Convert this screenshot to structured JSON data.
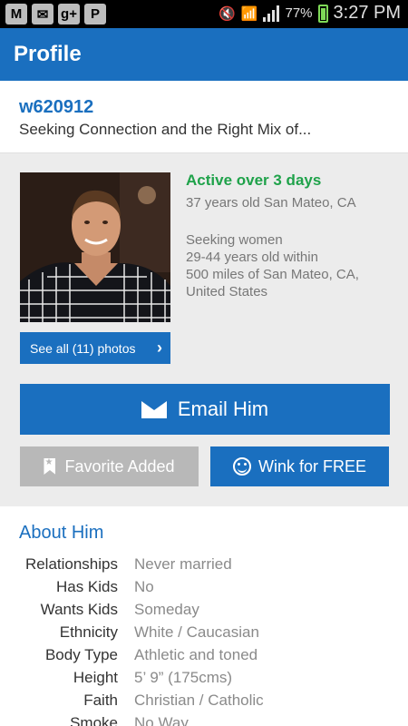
{
  "status_bar": {
    "icons": [
      "gmail-icon",
      "voicemail-icon",
      "google-plus-icon",
      "pinterest-icon"
    ],
    "icon_glyphs": [
      "M",
      "✉",
      "g+",
      "P"
    ],
    "battery": "77%",
    "time": "3:27 PM"
  },
  "appbar": {
    "title": "Profile"
  },
  "profile": {
    "username": "w620912",
    "headline": "Seeking Connection and the Right Mix of...",
    "activity": "Active over 3 days",
    "age_location": "37 years old San Mateo, CA",
    "seeking": {
      "line1": "Seeking women",
      "line2": "29-44 years old within",
      "line3": "500 miles of San Mateo, CA,",
      "line4": "United States"
    },
    "photos_button": "See all (11) photos"
  },
  "actions": {
    "email": "Email Him",
    "favorite": "Favorite Added",
    "wink": "Wink for FREE"
  },
  "about": {
    "title": "About Him",
    "details": [
      {
        "label": "Relationships",
        "value": "Never married"
      },
      {
        "label": "Has Kids",
        "value": "No"
      },
      {
        "label": "Wants Kids",
        "value": "Someday"
      },
      {
        "label": "Ethnicity",
        "value": "White / Caucasian"
      },
      {
        "label": "Body Type",
        "value": "Athletic and toned"
      },
      {
        "label": "Height",
        "value": "5’ 9” (175cms)"
      },
      {
        "label": "Faith",
        "value": "Christian / Catholic"
      },
      {
        "label": "Smoke",
        "value": "No Way"
      }
    ]
  },
  "colors": {
    "brand_blue": "#1a6fbf",
    "active_green": "#1fa24a",
    "favorite_gray": "#b8b8b8"
  }
}
